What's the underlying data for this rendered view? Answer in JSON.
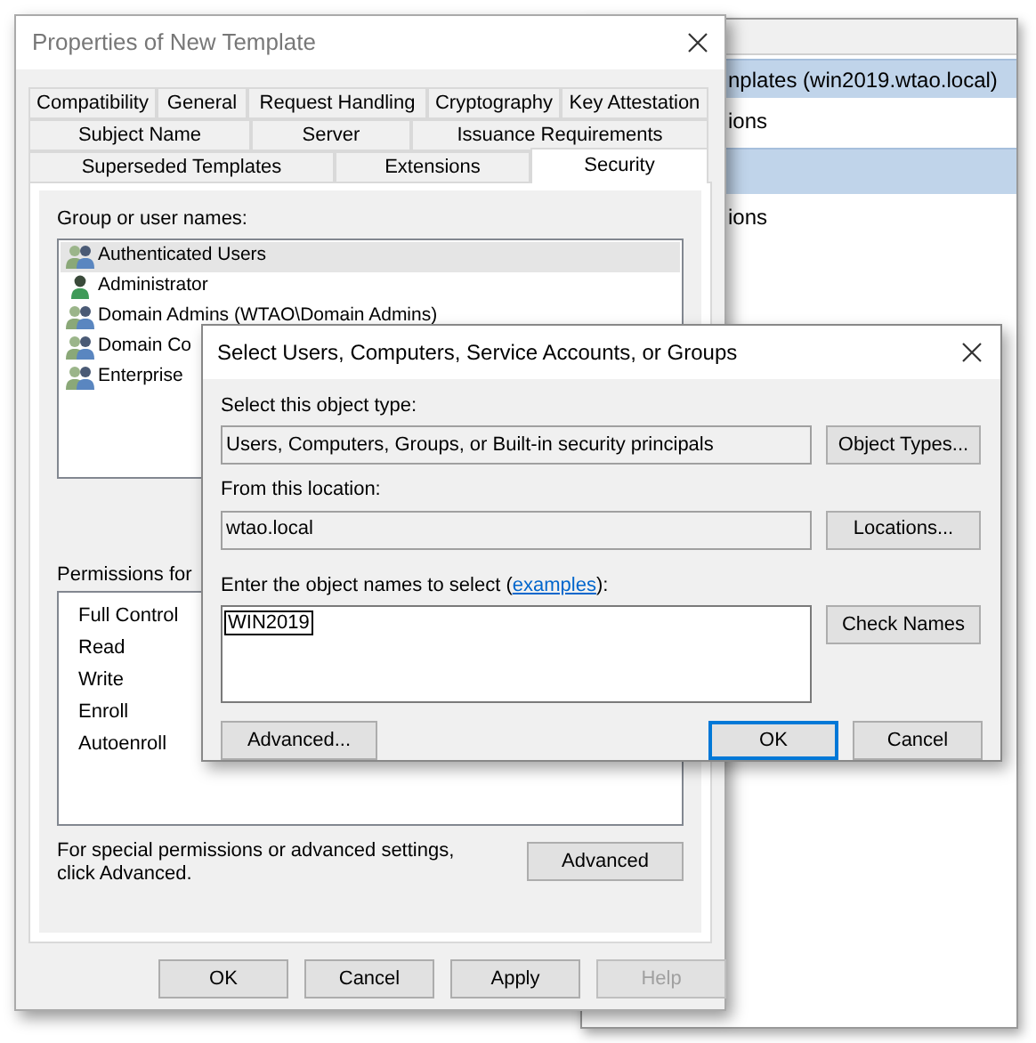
{
  "background_window": {
    "rows": [
      {
        "text": "nplates (win2019.wtao.local)",
        "selected": true
      },
      {
        "text": "ions",
        "selected": false
      },
      {
        "selected": true
      },
      {
        "text": "ions",
        "selected": false
      }
    ]
  },
  "properties_dialog": {
    "title": "Properties of New Template",
    "tab_rows": [
      [
        {
          "label": "Compatibility",
          "selected": false
        },
        {
          "label": "General",
          "selected": false
        },
        {
          "label": "Request Handling",
          "selected": false
        },
        {
          "label": "Cryptography",
          "selected": false
        },
        {
          "label": "Key Attestation",
          "selected": false
        }
      ],
      [
        {
          "label": "Subject Name",
          "selected": false
        },
        {
          "label": "Server",
          "selected": false
        },
        {
          "label": "Issuance Requirements",
          "selected": false
        }
      ],
      [
        {
          "label": "Superseded Templates",
          "selected": false
        },
        {
          "label": "Extensions",
          "selected": false
        },
        {
          "label": "Security",
          "selected": true
        }
      ]
    ],
    "group_label": "Group or user names:",
    "groups": [
      {
        "name": "Authenticated Users",
        "kind": "group",
        "selected": true
      },
      {
        "name": "Administrator",
        "kind": "user",
        "selected": false
      },
      {
        "name": "Domain Admins (WTAO\\Domain Admins)",
        "kind": "group",
        "selected": false
      },
      {
        "name": "Domain Co",
        "kind": "group",
        "selected": false
      },
      {
        "name": "Enterprise",
        "kind": "group",
        "selected": false
      }
    ],
    "permissions_label": "Permissions for",
    "permissions": [
      "Full Control",
      "Read",
      "Write",
      "Enroll",
      "Autoenroll"
    ],
    "special_text": "For special permissions or advanced settings, click Advanced.",
    "advanced_button": "Advanced",
    "buttons": [
      {
        "label": "OK",
        "disabled": false
      },
      {
        "label": "Cancel",
        "disabled": false
      },
      {
        "label": "Apply",
        "disabled": false
      },
      {
        "label": "Help",
        "disabled": true
      }
    ]
  },
  "select_dialog": {
    "title": "Select Users, Computers, Service Accounts, or Groups",
    "object_type_label": "Select this object type:",
    "object_type_value": "Users, Computers, Groups, or Built-in security principals",
    "object_types_button": "Object Types...",
    "location_label": "From this location:",
    "location_value": "wtao.local",
    "locations_button": "Locations...",
    "names_label_before": "Enter the object names to select (",
    "names_label_link": "examples",
    "names_label_after": "):",
    "names_value": "WIN2019",
    "check_names_button": "Check Names",
    "advanced_button": "Advanced...",
    "ok_button": {
      "label": "OK",
      "default": true
    },
    "cancel_button": "Cancel"
  }
}
